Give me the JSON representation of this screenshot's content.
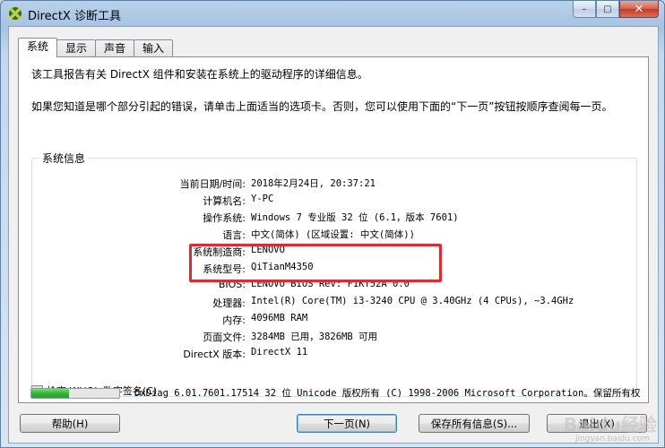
{
  "window": {
    "title": "DirectX 诊断工具",
    "caption_min": "–",
    "caption_max": "□",
    "caption_close": "✕"
  },
  "tabs": [
    {
      "label": "系统",
      "active": true
    },
    {
      "label": "显示",
      "active": false
    },
    {
      "label": "声音",
      "active": false
    },
    {
      "label": "输入",
      "active": false
    }
  ],
  "intro": {
    "line1": "该工具报告有关 DirectX 组件和安装在系统上的驱动程序的详细信息。",
    "line2": "如果您知道是哪个部分引起的错误，请单击上面适当的选项卡。否则，您可以使用下面的“下一页”按钮按顺序查阅每一页。"
  },
  "system_info": {
    "group_title": "系统信息",
    "rows": [
      {
        "label": "当前日期/时间:",
        "value": "2018年2月24日, 20:37:21"
      },
      {
        "label": "计算机名:",
        "value": "Y-PC"
      },
      {
        "label": "操作系统:",
        "value": "Windows 7 专业版 32 位 (6.1，版本 7601)"
      },
      {
        "label": "语言:",
        "value": "中文(简体) (区域设置: 中文(简体))"
      },
      {
        "label": "系统制造商:",
        "value": "LENOVO"
      },
      {
        "label": "系统型号:",
        "value": "QiTianM4350"
      },
      {
        "label": "BIOS:",
        "value": "LENOVO BIOS Rev: F1KT52A 0.0"
      },
      {
        "label": "处理器:",
        "value": "Intel(R) Core(TM) i3-3240 CPU @ 3.40GHz (4 CPUs), ~3.4GHz"
      },
      {
        "label": "内存:",
        "value": "4096MB RAM"
      },
      {
        "label": "页面文件:",
        "value": "3284MB 已用，3826MB 可用"
      },
      {
        "label": "DirectX 版本:",
        "value": "DirectX 11"
      }
    ]
  },
  "checkbox": {
    "label": "检查 WHQL 数字签名(C)",
    "checked": false
  },
  "status": {
    "progress_fraction": 0.43,
    "copyright": "DxDiag 6.01.7601.17514 32 位 Unicode 版权所有 (C) 1998-2006 Microsoft Corporation。保留所有权"
  },
  "buttons": {
    "help": "帮助(H)",
    "next": "下一页(N)",
    "save": "保存所有信息(S)...",
    "exit": "退出(X)"
  },
  "watermark": {
    "text": "Baidu经验",
    "url": "jingyan.baidu.com"
  },
  "colors": {
    "highlight_border": "#e8262d",
    "progress_green": "#2fb82f"
  }
}
